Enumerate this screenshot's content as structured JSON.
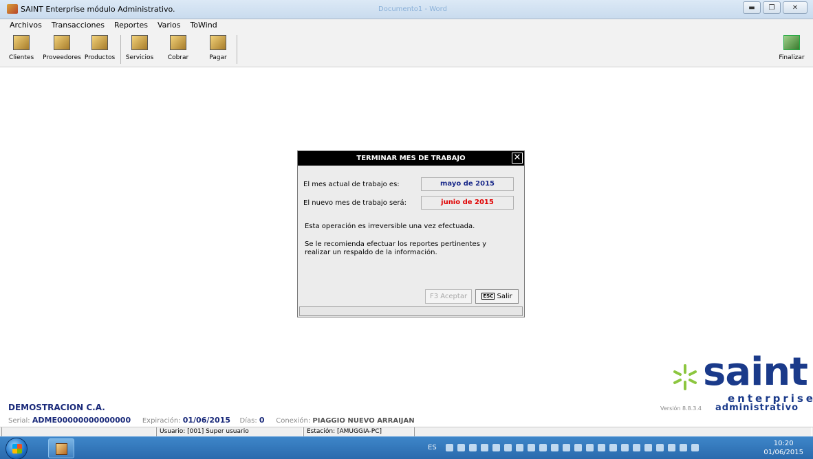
{
  "window": {
    "title": "SAINT Enterprise módulo Administrativo.",
    "ghost_title": "Documento1 - Word",
    "buttons": [
      "minimize",
      "maximize",
      "close"
    ]
  },
  "menu": {
    "items": [
      {
        "label": "Archivos"
      },
      {
        "label": "Transacciones"
      },
      {
        "label": "Reportes"
      },
      {
        "label": "Varios"
      },
      {
        "label": "ToWind"
      }
    ]
  },
  "toolbar": {
    "items": [
      {
        "label": "Clientes",
        "icon": "clients-icon"
      },
      {
        "label": "Proveedores",
        "icon": "suppliers-icon"
      },
      {
        "label": "Productos",
        "icon": "products-icon"
      },
      {
        "label": "Servicios",
        "icon": "services-icon"
      },
      {
        "label": "Cobrar",
        "icon": "collect-icon"
      },
      {
        "label": "Pagar",
        "icon": "pay-icon"
      }
    ],
    "exit": {
      "label": "Finalizar",
      "icon": "exit-door-icon"
    }
  },
  "dialog": {
    "title": "TERMINAR MES DE TRABAJO",
    "current_label": "El mes actual de trabajo es:",
    "current_value": "mayo de 2015",
    "current_color": "#1a2a8a",
    "new_label": "El nuevo mes de trabajo será:",
    "new_value": "junio de 2015",
    "new_color": "#e00000",
    "warning": "Esta operación es irreversible una vez efectuada.",
    "recommend_line1": "Se le recomienda efectuar los reportes pertinentes y",
    "recommend_line2": "realizar un respaldo de la información.",
    "accept_label": "F3 Aceptar",
    "exit_key": "ESC",
    "exit_label": "Salir"
  },
  "company": {
    "name": "DEMOSTRACION C.A.",
    "serial_label": "Serial:",
    "serial": "ADME00000000000000",
    "expiration_label": "Expiración:",
    "expiration": "01/06/2015",
    "days_label": "Días:",
    "days": "0",
    "connection_label": "Conexión:",
    "connection": "PIAGGIO NUEVO ARRAIJAN"
  },
  "logo": {
    "word": "saint",
    "enterprise": "enterprise",
    "version": "Versión 8.8.3.4",
    "module": "administrativo"
  },
  "statusbar": {
    "user": "Usuario: [001]  Super usuario",
    "station": "Estación: [AMUGGIA-PC]"
  },
  "taskbar": {
    "language": "ES",
    "time": "10:20",
    "date": "01/06/2015"
  }
}
